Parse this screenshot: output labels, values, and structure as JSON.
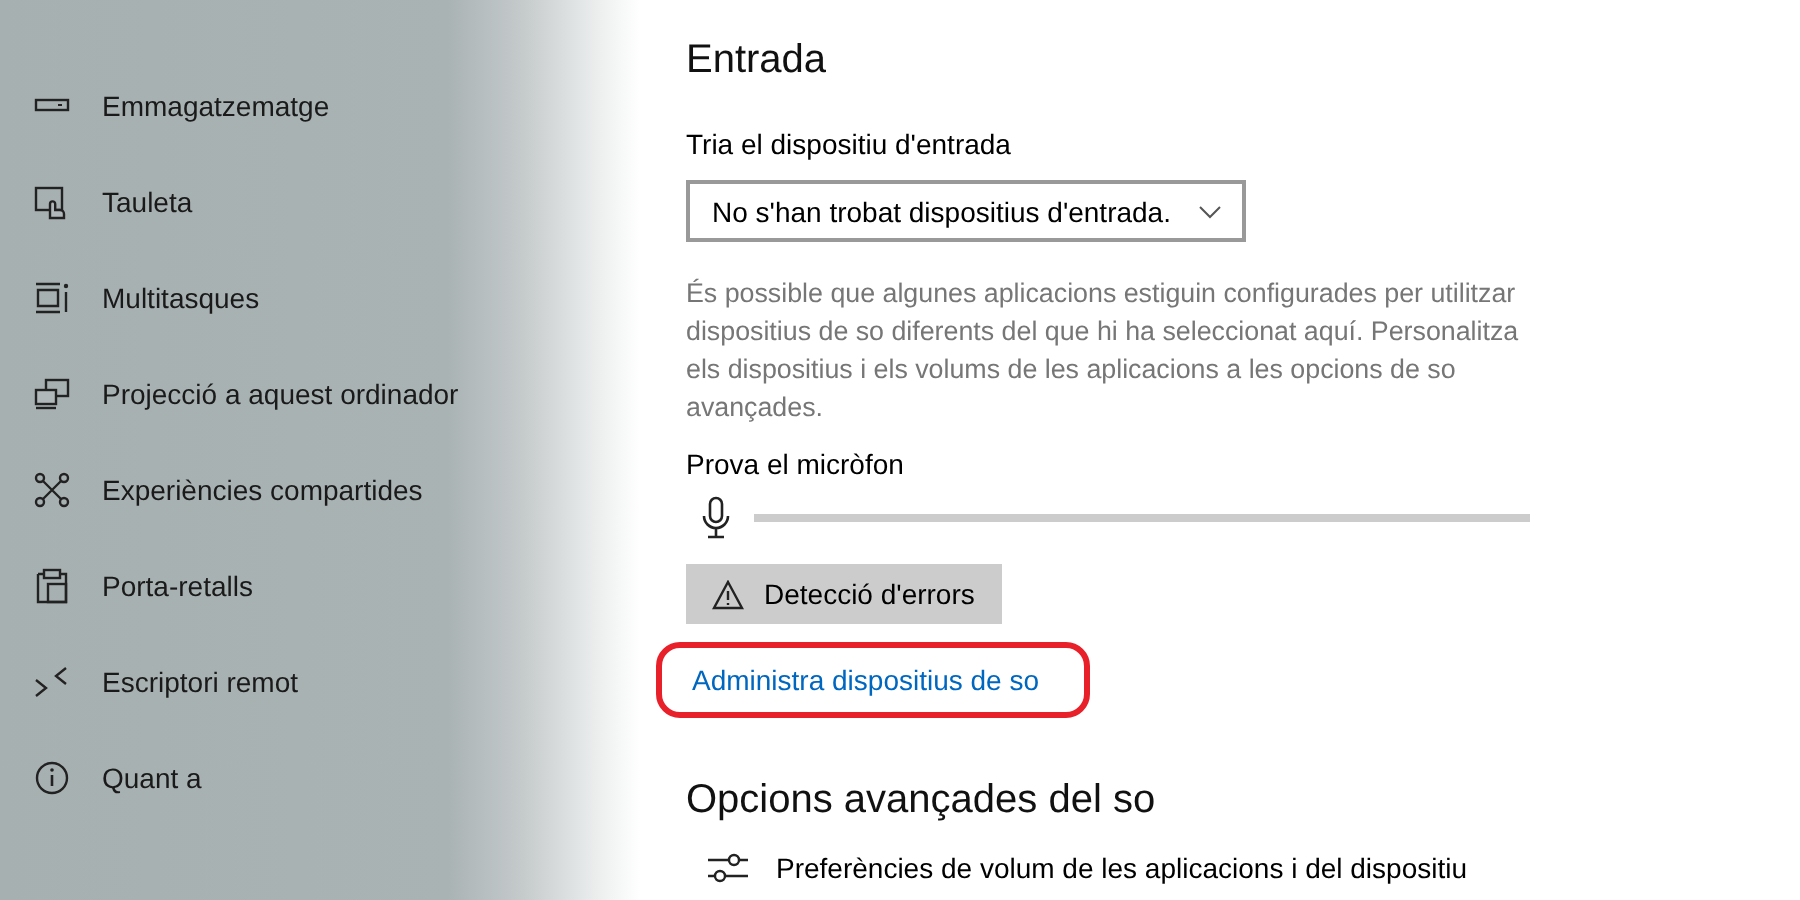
{
  "sidebar": {
    "items": [
      {
        "label": "Emmagatzematge"
      },
      {
        "label": "Tauleta"
      },
      {
        "label": "Multitasques"
      },
      {
        "label": "Projecció a aquest ordinador"
      },
      {
        "label": "Experiències compartides"
      },
      {
        "label": "Porta-retalls"
      },
      {
        "label": "Escriptori remot"
      },
      {
        "label": "Quant a"
      }
    ]
  },
  "input": {
    "heading": "Entrada",
    "device_label": "Tria el dispositiu d'entrada",
    "device_value": "No s'han trobat dispositius d'entrada.",
    "description": "És possible que algunes aplicacions estiguin configurades per utilitzar dispositius de so diferents del que hi ha seleccionat aquí. Personalitza els dispositius i els volums de les aplicacions a les opcions de so avançades.",
    "test_label": "Prova el micròfon",
    "mic_level": {
      "level": 0
    },
    "troubleshoot_button": "Detecció d'errors",
    "manage_link": {
      "label": "Administra dispositius de so",
      "highlighted": true
    }
  },
  "advanced": {
    "heading": "Opcions avançades del so",
    "items": [
      {
        "label": "Preferències de volum de les aplicacions i del dispositiu"
      }
    ]
  }
}
